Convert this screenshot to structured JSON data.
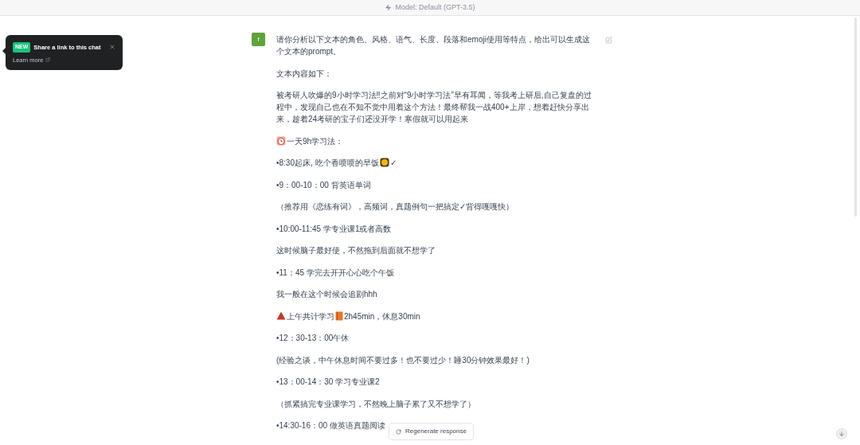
{
  "header": {
    "model": "Model: Default (GPT-3.5)"
  },
  "tooltip": {
    "badge": "NEW",
    "title": "Share a link to this chat",
    "link": "Learn more"
  },
  "message": {
    "avatar": "f",
    "paragraphs": [
      {
        "parts": [
          {
            "kind": "text",
            "text": "请你分析以下文本的角色、风格、语气、长度、段落和emoji使用等特点，给出可以生成这个文本的prompt。"
          }
        ]
      },
      {
        "parts": [
          {
            "kind": "text",
            "text": "文本内容如下："
          }
        ]
      },
      {
        "parts": [
          {
            "kind": "text",
            "text": "被考研人吹爆的9小时学习法‼之前对“9小时学习法”早有耳闻，等我考上研后,自己复盘的过程中，发现自己也在不知不觉中用着这个方法！最终帮我一战400+上岸，想着赶快分享出来，趁着24考研的宝子们还没开学！寒假就可以用起来"
          }
        ]
      },
      {
        "parts": [
          {
            "kind": "clock"
          },
          {
            "kind": "text",
            "text": "一天9h学习法："
          }
        ]
      },
      {
        "parts": [
          {
            "kind": "text",
            "text": "•8:30起床, 吃个香喷喷的早饭"
          },
          {
            "kind": "coin"
          },
          {
            "kind": "text",
            "text": "✓"
          }
        ]
      },
      {
        "parts": [
          {
            "kind": "text",
            "text": "•9：00-10：00 背英语单词"
          }
        ]
      },
      {
        "parts": [
          {
            "kind": "text",
            "text": "（推荐用《恋练有词》，高频词，真题例句一把搞定✓背得嘎嘎快）"
          }
        ]
      },
      {
        "parts": [
          {
            "kind": "text",
            "text": "•10:00-11:45 学专业课1或者高数"
          }
        ]
      },
      {
        "parts": [
          {
            "kind": "text",
            "text": "这时候脑子最好使，不然拖到后面就不想学了"
          }
        ]
      },
      {
        "parts": [
          {
            "kind": "text",
            "text": "•11：45 学完去开开心心吃个午饭"
          }
        ]
      },
      {
        "parts": [
          {
            "kind": "text",
            "text": "我一般在这个时候会追剧hhh"
          }
        ]
      },
      {
        "parts": [
          {
            "kind": "warning"
          },
          {
            "kind": "text",
            "text": "上午共计学习"
          },
          {
            "kind": "book"
          },
          {
            "kind": "text",
            "text": "2h45min，休息30min"
          }
        ]
      },
      {
        "parts": [
          {
            "kind": "text",
            "text": "•12：30-13：00午休"
          }
        ]
      },
      {
        "parts": [
          {
            "kind": "text",
            "text": "(经验之谈，中午休息时间不要过多！也不要过少！睡30分钟效果最好！)"
          }
        ]
      },
      {
        "parts": [
          {
            "kind": "text",
            "text": "•13：00-14：30 学习专业课2"
          }
        ]
      },
      {
        "parts": [
          {
            "kind": "text",
            "text": "（抓紧搞完专业课学习，不然晚上脑子累了又不想学了）"
          }
        ]
      },
      {
        "parts": [
          {
            "kind": "text",
            "text": "•14:30-16：00 做英语真题阅读"
          }
        ]
      }
    ]
  },
  "regenerate": {
    "label": "Regenerate response"
  }
}
